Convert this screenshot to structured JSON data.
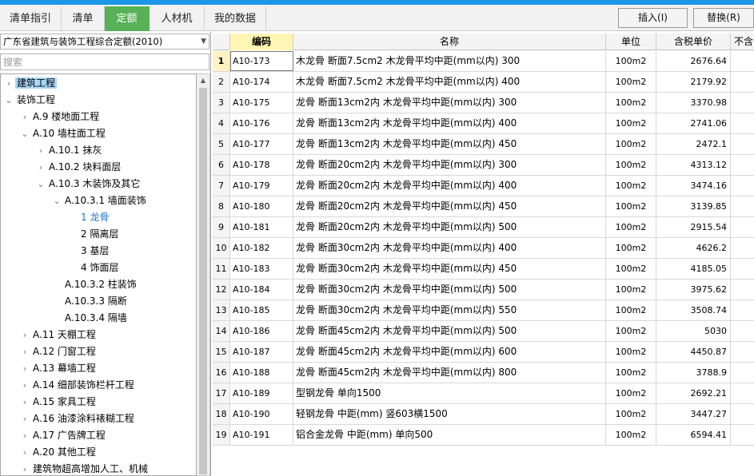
{
  "tabs": [
    {
      "label": "清单指引",
      "active": false
    },
    {
      "label": "清单",
      "active": false
    },
    {
      "label": "定额",
      "active": true
    },
    {
      "label": "人材机",
      "active": false
    },
    {
      "label": "我的数据",
      "active": false
    }
  ],
  "toolbar": {
    "insert_label": "插入(I)",
    "replace_label": "替换(R)"
  },
  "library": {
    "selected": "广东省建筑与装饰工程综合定额(2010)"
  },
  "search": {
    "placeholder": "搜索"
  },
  "tree": [
    {
      "label": "建筑工程",
      "toggle": "collapsed",
      "selected": true
    },
    {
      "label": "装饰工程",
      "toggle": "expanded"
    },
    {
      "label": "A.9 楼地面工程",
      "toggle": "collapsed"
    },
    {
      "label": "A.10 墙柱面工程",
      "toggle": "expanded"
    },
    {
      "label": "A.10.1 抹灰",
      "toggle": "collapsed"
    },
    {
      "label": "A.10.2 块料面层",
      "toggle": "collapsed"
    },
    {
      "label": "A.10.3 木装饰及其它",
      "toggle": "expanded"
    },
    {
      "label": "A.10.3.1 墙面装饰",
      "toggle": "expanded"
    },
    {
      "label": "1 龙骨",
      "toggle": "none",
      "current": true
    },
    {
      "label": "2 隔离层",
      "toggle": "none"
    },
    {
      "label": "3 基层",
      "toggle": "none"
    },
    {
      "label": "4 饰面层",
      "toggle": "none"
    },
    {
      "label": "A.10.3.2 柱装饰",
      "toggle": "none"
    },
    {
      "label": "A.10.3.3 隔断",
      "toggle": "none"
    },
    {
      "label": "A.10.3.4 隔墙",
      "toggle": "none"
    },
    {
      "label": "A.11 天棚工程",
      "toggle": "collapsed"
    },
    {
      "label": "A.12 门窗工程",
      "toggle": "collapsed"
    },
    {
      "label": "A.13 幕墙工程",
      "toggle": "collapsed"
    },
    {
      "label": "A.14 细部装饰栏杆工程",
      "toggle": "collapsed"
    },
    {
      "label": "A.15 家具工程",
      "toggle": "collapsed"
    },
    {
      "label": "A.16 油漆涂料裱糊工程",
      "toggle": "collapsed"
    },
    {
      "label": "A.17 广告牌工程",
      "toggle": "collapsed"
    },
    {
      "label": "A.20 其他工程",
      "toggle": "collapsed"
    },
    {
      "label": "建筑物超高增加人工、机械",
      "toggle": "collapsed"
    }
  ],
  "table": {
    "columns": [
      "编码",
      "名称",
      "单位",
      "含税单价",
      "不含"
    ],
    "rows": [
      {
        "num": "1",
        "code": "A10-173",
        "name": "木龙骨 断面7.5cm2 木龙骨平均中距(mm以内) 300",
        "unit": "100m2",
        "price": "2676.64",
        "selected": true
      },
      {
        "num": "2",
        "code": "A10-174",
        "name": "木龙骨 断面7.5cm2 木龙骨平均中距(mm以内) 400",
        "unit": "100m2",
        "price": "2179.92"
      },
      {
        "num": "3",
        "code": "A10-175",
        "name": "龙骨 断面13cm2内 木龙骨平均中距(mm以内) 300",
        "unit": "100m2",
        "price": "3370.98"
      },
      {
        "num": "4",
        "code": "A10-176",
        "name": "龙骨 断面13cm2内 木龙骨平均中距(mm以内) 400",
        "unit": "100m2",
        "price": "2741.06"
      },
      {
        "num": "5",
        "code": "A10-177",
        "name": "龙骨 断面13cm2内 木龙骨平均中距(mm以内) 450",
        "unit": "100m2",
        "price": "2472.1"
      },
      {
        "num": "6",
        "code": "A10-178",
        "name": "龙骨 断面20cm2内 木龙骨平均中距(mm以内) 300",
        "unit": "100m2",
        "price": "4313.12"
      },
      {
        "num": "7",
        "code": "A10-179",
        "name": "龙骨 断面20cm2内 木龙骨平均中距(mm以内) 400",
        "unit": "100m2",
        "price": "3474.16"
      },
      {
        "num": "8",
        "code": "A10-180",
        "name": "龙骨 断面20cm2内 木龙骨平均中距(mm以内) 450",
        "unit": "100m2",
        "price": "3139.85"
      },
      {
        "num": "9",
        "code": "A10-181",
        "name": "龙骨 断面20cm2内 木龙骨平均中距(mm以内) 500",
        "unit": "100m2",
        "price": "2915.54"
      },
      {
        "num": "10",
        "code": "A10-182",
        "name": "龙骨 断面30cm2内 木龙骨平均中距(mm以内) 400",
        "unit": "100m2",
        "price": "4626.2"
      },
      {
        "num": "11",
        "code": "A10-183",
        "name": "龙骨 断面30cm2内 木龙骨平均中距(mm以内) 450",
        "unit": "100m2",
        "price": "4185.05"
      },
      {
        "num": "12",
        "code": "A10-184",
        "name": "龙骨 断面30cm2内 木龙骨平均中距(mm以内) 500",
        "unit": "100m2",
        "price": "3975.62"
      },
      {
        "num": "13",
        "code": "A10-185",
        "name": "龙骨 断面30cm2内 木龙骨平均中距(mm以内) 550",
        "unit": "100m2",
        "price": "3508.74"
      },
      {
        "num": "14",
        "code": "A10-186",
        "name": "龙骨 断面45cm2内 木龙骨平均中距(mm以内) 500",
        "unit": "100m2",
        "price": "5030"
      },
      {
        "num": "15",
        "code": "A10-187",
        "name": "龙骨 断面45cm2内 木龙骨平均中距(mm以内) 600",
        "unit": "100m2",
        "price": "4450.87"
      },
      {
        "num": "16",
        "code": "A10-188",
        "name": "龙骨 断面45cm2内 木龙骨平均中距(mm以内) 800",
        "unit": "100m2",
        "price": "3788.9"
      },
      {
        "num": "17",
        "code": "A10-189",
        "name": "型钢龙骨 单向1500",
        "unit": "100m2",
        "price": "2692.21"
      },
      {
        "num": "18",
        "code": "A10-190",
        "name": "轻钢龙骨 中距(mm) 竖603横1500",
        "unit": "100m2",
        "price": "3447.27"
      },
      {
        "num": "19",
        "code": "A10-191",
        "name": "铝合金龙骨 中距(mm) 单向500",
        "unit": "100m2",
        "price": "6594.41"
      }
    ]
  }
}
